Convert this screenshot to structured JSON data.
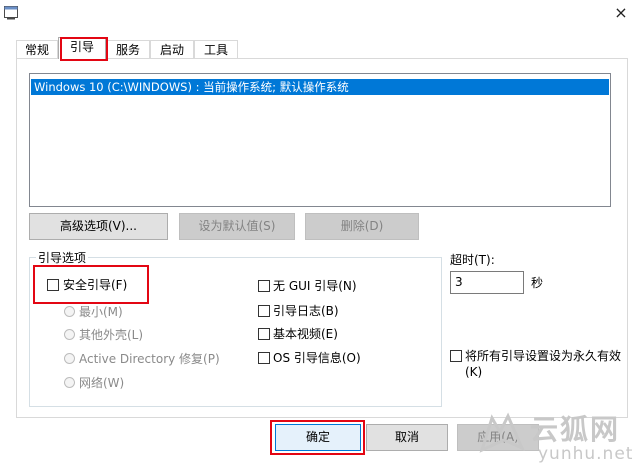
{
  "tabs": [
    "常规",
    "引导",
    "服务",
    "启动",
    "工具"
  ],
  "os_list": [
    "Windows 10 (C:\\WINDOWS) : 当前操作系统; 默认操作系统"
  ],
  "buttons": {
    "advanced": "高级选项(V)...",
    "set_default": "设为默认值(S)",
    "delete": "删除(D)",
    "ok": "确定",
    "cancel": "取消",
    "apply": "应用(A)"
  },
  "boot_options": {
    "legend": "引导选项",
    "safe_boot": "安全引导(F)",
    "minimal": "最小(M)",
    "alternate_shell": "其他外壳(L)",
    "active_directory": "Active Directory 修复(P)",
    "network": "网络(W)",
    "no_gui": "无 GUI 引导(N)",
    "boot_log": "引导日志(B)",
    "base_video": "基本视频(E)",
    "os_boot_info": "OS 引导信息(O)"
  },
  "timeout": {
    "label": "超时(T):",
    "value": "3",
    "unit": "秒"
  },
  "make_permanent": {
    "label": "将所有引导设置设为永久有效",
    "label_line2": "(K)"
  },
  "close_glyph": "×",
  "watermark": {
    "title": "云狐网",
    "url": "yunhu.net"
  }
}
